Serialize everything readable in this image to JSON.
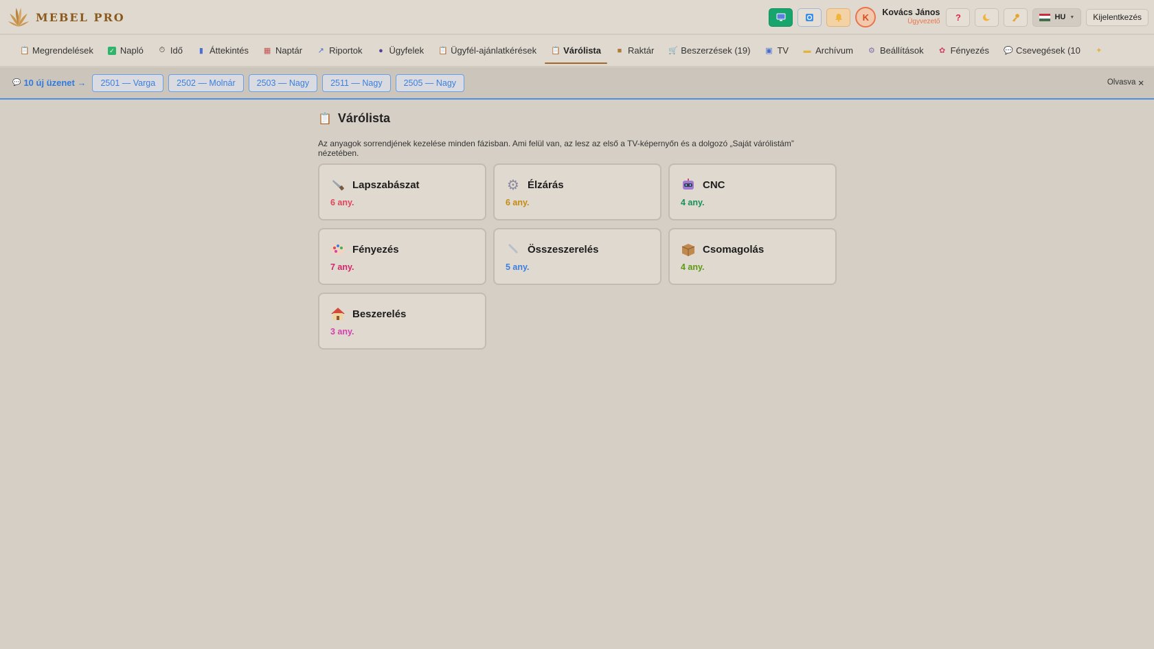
{
  "brand": {
    "name": "MEBEL PRO"
  },
  "header": {
    "user_name": "Kovács János",
    "user_role": "Ügyvezető",
    "avatar_letter": "K",
    "language": "HU",
    "logout_label": "Kijelentkezés",
    "help_label": "?",
    "colors": {
      "green_button": "#17a56d",
      "avatar_accent": "#e8734c"
    }
  },
  "nav": {
    "items": [
      {
        "label": "Megrendelések",
        "icon": "clipboard-icon"
      },
      {
        "label": "Napló",
        "icon": "check-icon"
      },
      {
        "label": "Idő",
        "icon": "stopwatch-icon"
      },
      {
        "label": "Áttekintés",
        "icon": "bar-chart-icon"
      },
      {
        "label": "Naptár",
        "icon": "calendar-icon"
      },
      {
        "label": "Riportok",
        "icon": "line-chart-icon"
      },
      {
        "label": "Ügyfelek",
        "icon": "users-icon"
      },
      {
        "label": "Ügyfél-ajánlatkérések",
        "icon": "clipboard-icon"
      },
      {
        "label": "Várólista",
        "icon": "clipboard-icon",
        "active": true
      },
      {
        "label": "Raktár",
        "icon": "box-icon"
      },
      {
        "label": "Beszerzések (19)",
        "icon": "cart-icon"
      },
      {
        "label": "TV",
        "icon": "tv-icon"
      },
      {
        "label": "Archívum",
        "icon": "folder-icon"
      },
      {
        "label": "Beállítások",
        "icon": "gear-icon"
      },
      {
        "label": "Fényezés",
        "icon": "palette-icon"
      },
      {
        "label": "Csevegések (10",
        "icon": "chat-icon"
      }
    ]
  },
  "messages": {
    "count_label": "10 új üzenet →",
    "chips": [
      "2501 — Varga",
      "2502 — Molnár",
      "2503 — Nagy",
      "2511 — Nagy",
      "2505 — Nagy"
    ],
    "read_label": "Olvasva",
    "accent": "#2f7ae0"
  },
  "page": {
    "title": "Várólista",
    "description": "Az anyagok sorrendjének kezelése minden fázisban. Ami felül van, az lesz az első a TV-képernyőn és a dolgozó „Saját várólistám” nézetében."
  },
  "phases": [
    {
      "name": "Lapszabászat",
      "count": "6 any.",
      "color": "#e0455a",
      "icon": "saw-icon"
    },
    {
      "name": "Élzárás",
      "count": "6 any.",
      "color": "#c48a12",
      "icon": "gear-icon"
    },
    {
      "name": "CNC",
      "count": "4 any.",
      "color": "#13905e",
      "icon": "robot-icon"
    },
    {
      "name": "Fényezés",
      "count": "7 any.",
      "color": "#d2256b",
      "icon": "palette-icon"
    },
    {
      "name": "Összeszerelés",
      "count": "5 any.",
      "color": "#3b7fe0",
      "icon": "wrench-icon"
    },
    {
      "name": "Csomagolás",
      "count": "4 any.",
      "color": "#5a9a12",
      "icon": "package-icon"
    },
    {
      "name": "Beszerelés",
      "count": "3 any.",
      "color": "#d43fb0",
      "icon": "house-icon"
    }
  ]
}
